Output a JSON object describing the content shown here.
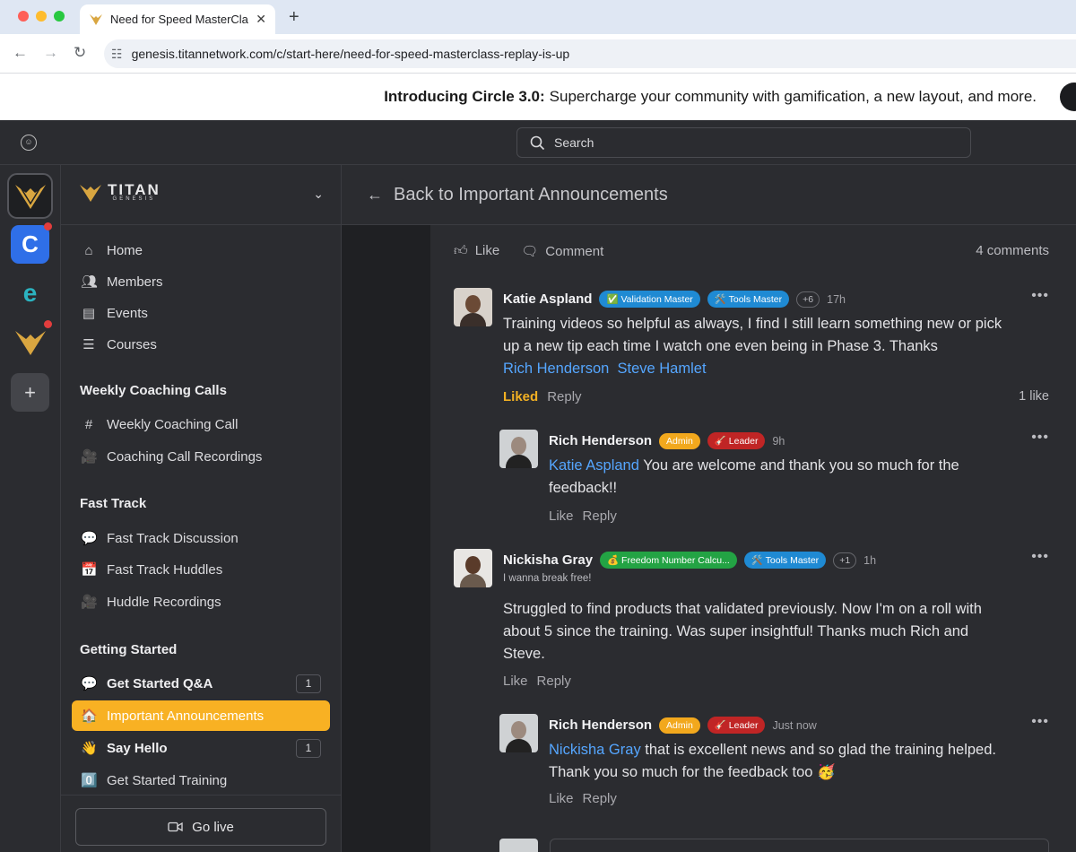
{
  "browser": {
    "tab_title": "Need for Speed MasterClass",
    "url": "genesis.titannetwork.com/c/start-here/need-for-speed-masterclass-replay-is-up"
  },
  "banner": {
    "bold": "Introducing Circle 3.0:",
    "text": "Supercharge your community with gamification, a new layout, and more."
  },
  "topbar": {
    "search_placeholder": "Search"
  },
  "brand": {
    "name": "TITAN",
    "sub": "GENESIS"
  },
  "sidebar": {
    "nav": [
      "Home",
      "Members",
      "Events",
      "Courses"
    ],
    "sections": [
      {
        "title": "Weekly Coaching Calls",
        "items": [
          {
            "label": "Weekly Coaching Call",
            "icon": "#"
          },
          {
            "label": "Coaching Call Recordings",
            "icon": "🎥"
          }
        ]
      },
      {
        "title": "Fast Track",
        "items": [
          {
            "label": "Fast Track Discussion",
            "icon": "💬"
          },
          {
            "label": "Fast Track Huddles",
            "icon": "📅"
          },
          {
            "label": "Huddle Recordings",
            "icon": "🎥"
          }
        ]
      },
      {
        "title": "Getting Started",
        "items": [
          {
            "label": "Get Started Q&A",
            "icon": "💬",
            "count": "1"
          },
          {
            "label": "Important Announcements",
            "icon": "🏠"
          },
          {
            "label": "Say Hello",
            "icon": "👋",
            "count": "1"
          },
          {
            "label": "Get Started Training",
            "icon": "0️⃣"
          }
        ]
      }
    ],
    "go_live": "Go live"
  },
  "main": {
    "back_label": "Back to Important Announcements",
    "like": "Like",
    "comment": "Comment",
    "comments_count": "4 comments"
  },
  "comments": [
    {
      "name": "Katie Aspland",
      "badges": [
        "✅ Validation Master",
        "🛠️ Tools Master",
        "+6"
      ],
      "time": "17h",
      "body_pre": "Training videos so helpful as always, I find I still learn something new or pick up a new tip each time I watch one even being in Phase 3. Thanks",
      "mentions": [
        "Rich Henderson",
        "Steve Hamlet"
      ],
      "liked": "Liked",
      "reply": "Reply",
      "likes": "1 like"
    },
    {
      "name": "Rich Henderson",
      "badges": [
        "Admin",
        "🎸 Leader"
      ],
      "time": "9h",
      "mention": "Katie Aspland",
      "body": "You are welcome and thank you so much for the feedback!!",
      "like": "Like",
      "reply": "Reply"
    },
    {
      "name": "Nickisha Gray",
      "badges": [
        "💰 Freedom Number Calcu...",
        "🛠️ Tools Master",
        "+1"
      ],
      "time": "1h",
      "subtitle": "I wanna break free!",
      "body": "Struggled to find products that validated previously. Now I'm on a roll with about 5 since the training. Was super insightful! Thanks much Rich and Steve.",
      "like": "Like",
      "reply": "Reply"
    },
    {
      "name": "Rich Henderson",
      "badges": [
        "Admin",
        "🎸 Leader"
      ],
      "time": "Just now",
      "mention": "Nickisha Gray",
      "body": "that is excellent news and so glad the training helped. Thank you so much for the feedback too 🥳",
      "like": "Like",
      "reply": "Reply"
    }
  ],
  "colors": {
    "accent": "#f8b123",
    "mention": "#55a6ff",
    "background": "#2b2c30"
  }
}
